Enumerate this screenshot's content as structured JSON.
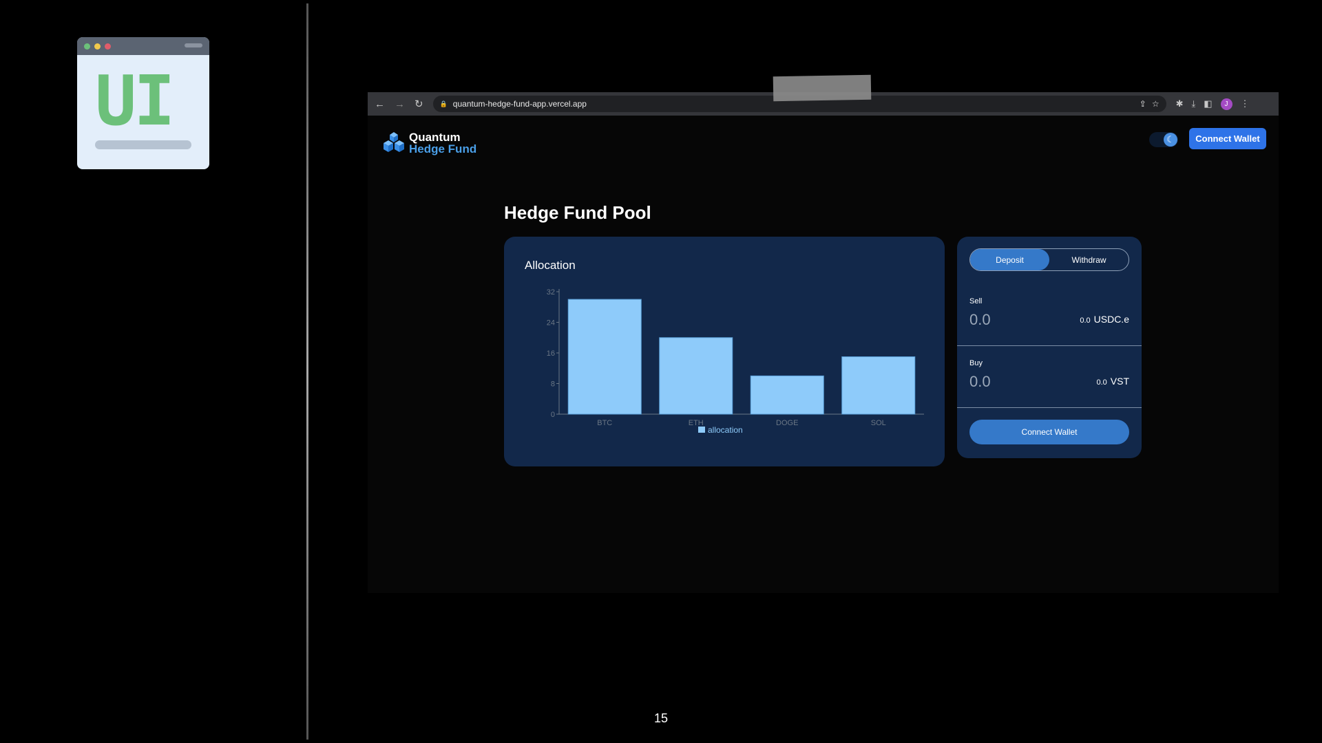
{
  "slide": {
    "icon_text": "UI",
    "page_number": "15"
  },
  "browser": {
    "url": "quantum-hedge-fund-app.vercel.app",
    "profile_initial": "J"
  },
  "header": {
    "logo_line1": "Quantum",
    "logo_line2": "Hedge Fund",
    "connect_label": "Connect Wallet",
    "theme": "dark"
  },
  "main": {
    "title": "Hedge Fund Pool"
  },
  "chart_data": {
    "type": "bar",
    "title": "Allocation",
    "categories": [
      "BTC",
      "ETH",
      "DOGE",
      "SOL"
    ],
    "series": [
      {
        "name": "allocation",
        "values": [
          30,
          20,
          10,
          15
        ]
      }
    ],
    "yticks": [
      0,
      8,
      16,
      24,
      32
    ],
    "ylim": [
      0,
      32
    ],
    "legend": "bottom",
    "color": "#8ecbfa"
  },
  "swap": {
    "tabs": [
      "Deposit",
      "Withdraw"
    ],
    "active_tab": "Deposit",
    "sell": {
      "label": "Sell",
      "amount": "0.0",
      "balance": "0.0",
      "token": "USDC.e"
    },
    "buy": {
      "label": "Buy",
      "amount": "0.0",
      "balance": "0.0",
      "token": "VST"
    },
    "button": "Connect Wallet"
  }
}
